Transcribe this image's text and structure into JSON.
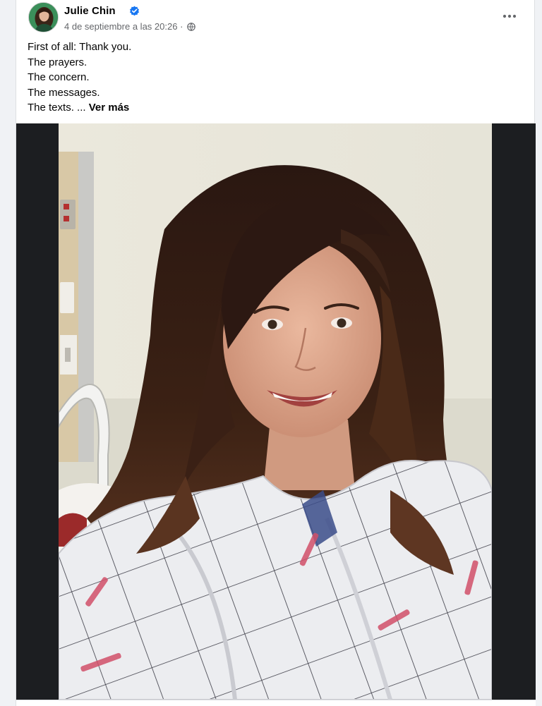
{
  "post": {
    "author": "Julie Chin",
    "verified_icon": "verified-badge-icon",
    "timestamp": "4 de septiembre a las 20:26",
    "separator": "·",
    "audience_icon": "globe-icon",
    "more_icon": "more-options-icon",
    "text_lines": [
      "First of all: Thank you.",
      "The prayers.",
      "The concern.",
      "The messages."
    ],
    "last_line": "The texts.",
    "ellipsis": "...",
    "see_more_label": "Ver más",
    "photo_icon": "post-photo",
    "colors": {
      "verified": "#1877f2",
      "secondary_text": "#65676b",
      "media_background": "#1c1e21"
    }
  }
}
